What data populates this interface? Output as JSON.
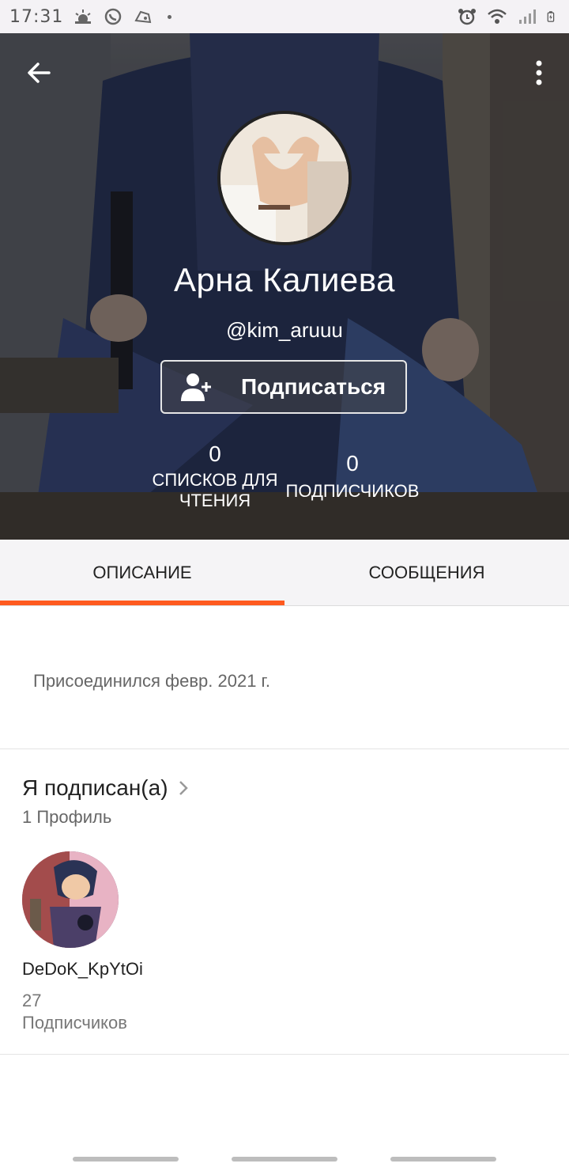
{
  "status_bar": {
    "time": "17:31",
    "left_icons": [
      "weather-icon",
      "whatsapp-icon",
      "gamepad-icon",
      "dot-icon"
    ],
    "right_icons": [
      "alarm-icon",
      "wifi-icon",
      "signal-icon",
      "battery-icon"
    ]
  },
  "header": {
    "back_icon": "arrow-left-icon",
    "more_icon": "more-vertical-icon",
    "name": "Арна Калиева",
    "handle": "@kim_aruuu",
    "follow_button": "Подписаться",
    "stats": {
      "lists_count": "0",
      "lists_label_line1": "СПИСКОВ ДЛЯ",
      "lists_label_line2": "ЧТЕНИЯ",
      "followers_count": "0",
      "followers_label": "ПОДПИСЧИКОВ"
    }
  },
  "tabs": [
    {
      "label": "ОПИСАНИЕ",
      "active": true
    },
    {
      "label": "СООБЩЕНИЯ",
      "active": false
    }
  ],
  "about": {
    "joined": "Присоединился февр. 2021 г."
  },
  "following": {
    "title": "Я подписан(а)",
    "subtitle": "1 Профиль",
    "profiles": [
      {
        "name": "DeDoK_KpYtOi",
        "followers_count": "27",
        "followers_label": "Подписчиков"
      }
    ]
  },
  "colors": {
    "accent": "#ff5a1f",
    "tab_bg": "#f5f4f6",
    "status_bar_bg": "#f4f2f5"
  }
}
